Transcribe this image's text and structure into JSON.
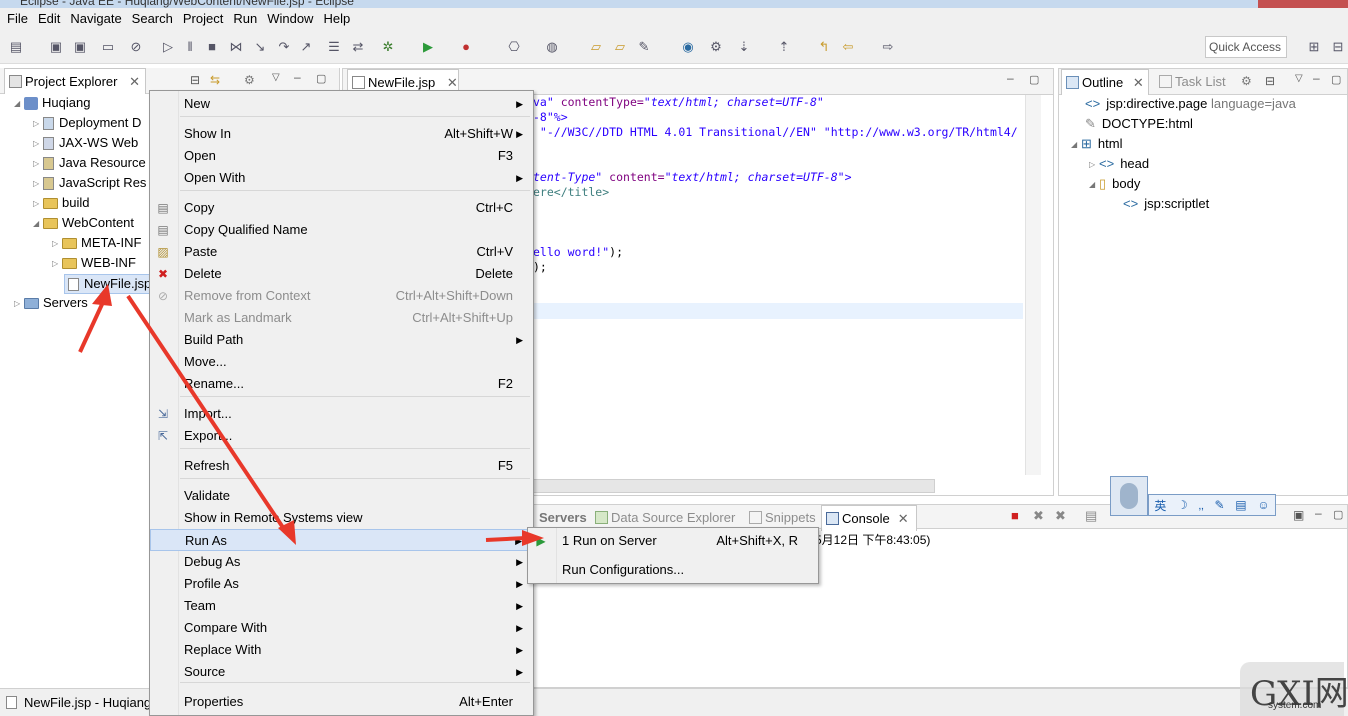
{
  "window": {
    "title": "Eclipse - Java EE - Huqiang/WebContent/NewFile.jsp - Eclipse"
  },
  "menubar": [
    "File",
    "Edit",
    "Navigate",
    "Search",
    "Project",
    "Run",
    "Window",
    "Help"
  ],
  "toolbar": {
    "quick_access": "Quick Access"
  },
  "project_explorer": {
    "tab": "Project Explorer",
    "tree": [
      {
        "label": "Huqiang"
      },
      {
        "label": "Deployment D"
      },
      {
        "label": "JAX-WS Web"
      },
      {
        "label": "Java Resource"
      },
      {
        "label": "JavaScript Res"
      },
      {
        "label": "build"
      },
      {
        "label": "WebContent"
      },
      {
        "label": "META-INF"
      },
      {
        "label": "WEB-INF"
      },
      {
        "label": "NewFile.jsp"
      },
      {
        "label": "Servers"
      }
    ]
  },
  "editor": {
    "tab": "NewFile.jsp",
    "lines": [
      {
        "a": "va\"",
        "b": " contentType=",
        "c": "\"text/html; charset=UTF-8\""
      },
      {
        "a": "-8\"%>",
        "b": "",
        "c": ""
      },
      {
        "a": "",
        "b": " \"-//W3C//DTD HTML 4.01 Transitional//EN\" \"http://www.w3.org/TR/html4/",
        "c": ""
      },
      {
        "a": "tent-Type\"",
        "b": " content=",
        "c": "\"text/html; charset=UTF-8\">"
      },
      {
        "a": "",
        "b": "ere</title>",
        "c": ""
      },
      {
        "a": "ello word!\"",
        "b": ");",
        "c": ""
      },
      {
        "a": "",
        "b": ");",
        "c": ""
      }
    ]
  },
  "outline": {
    "tabs": [
      "Outline",
      "Task List"
    ],
    "items": [
      {
        "label": "jsp:directive.page",
        "extra": " language=java"
      },
      {
        "label": "DOCTYPE:html",
        "extra": ""
      },
      {
        "label": "html",
        "extra": ""
      },
      {
        "label": "head",
        "extra": ""
      },
      {
        "label": "body",
        "extra": ""
      },
      {
        "label": "jsp:scriptlet",
        "extra": ""
      }
    ]
  },
  "bottom_panel": {
    "tabs": [
      "Servers",
      "Data Source Explorer",
      "Snippets",
      "Console"
    ],
    "console_text": "5月12日 下午8:43:05)"
  },
  "status": {
    "text": "NewFile.jsp - Huqiang"
  },
  "ime": {
    "label": "英"
  },
  "context_menu": {
    "items": [
      {
        "label": "New",
        "shortcut": "",
        "submenu": true,
        "disabled": false
      },
      {
        "label": "Show In",
        "shortcut": "Alt+Shift+W",
        "submenu": true,
        "disabled": false
      },
      {
        "label": "Open",
        "shortcut": "F3",
        "submenu": false,
        "disabled": false
      },
      {
        "label": "Open With",
        "shortcut": "",
        "submenu": true,
        "disabled": false
      },
      {
        "label": "Copy",
        "shortcut": "Ctrl+C",
        "submenu": false,
        "disabled": false
      },
      {
        "label": "Copy Qualified Name",
        "shortcut": "",
        "submenu": false,
        "disabled": false
      },
      {
        "label": "Paste",
        "shortcut": "Ctrl+V",
        "submenu": false,
        "disabled": false
      },
      {
        "label": "Delete",
        "shortcut": "Delete",
        "submenu": false,
        "disabled": false
      },
      {
        "label": "Remove from Context",
        "shortcut": "Ctrl+Alt+Shift+Down",
        "submenu": false,
        "disabled": true
      },
      {
        "label": "Mark as Landmark",
        "shortcut": "Ctrl+Alt+Shift+Up",
        "submenu": false,
        "disabled": true
      },
      {
        "label": "Build Path",
        "shortcut": "",
        "submenu": true,
        "disabled": false
      },
      {
        "label": "Move...",
        "shortcut": "",
        "submenu": false,
        "disabled": false
      },
      {
        "label": "Rename...",
        "shortcut": "F2",
        "submenu": false,
        "disabled": false
      },
      {
        "label": "Import...",
        "shortcut": "",
        "submenu": false,
        "disabled": false
      },
      {
        "label": "Export...",
        "shortcut": "",
        "submenu": false,
        "disabled": false
      },
      {
        "label": "Refresh",
        "shortcut": "F5",
        "submenu": false,
        "disabled": false
      },
      {
        "label": "Validate",
        "shortcut": "",
        "submenu": false,
        "disabled": false
      },
      {
        "label": "Show in Remote Systems view",
        "shortcut": "",
        "submenu": false,
        "disabled": false
      },
      {
        "label": "Run As",
        "shortcut": "",
        "submenu": true,
        "disabled": false
      },
      {
        "label": "Debug As",
        "shortcut": "",
        "submenu": true,
        "disabled": false
      },
      {
        "label": "Profile As",
        "shortcut": "",
        "submenu": true,
        "disabled": false
      },
      {
        "label": "Team",
        "shortcut": "",
        "submenu": true,
        "disabled": false
      },
      {
        "label": "Compare With",
        "shortcut": "",
        "submenu": true,
        "disabled": false
      },
      {
        "label": "Replace With",
        "shortcut": "",
        "submenu": true,
        "disabled": false
      },
      {
        "label": "Source",
        "shortcut": "",
        "submenu": true,
        "disabled": false
      },
      {
        "label": "Properties",
        "shortcut": "Alt+Enter",
        "submenu": false,
        "disabled": false
      }
    ]
  },
  "run_as_submenu": [
    {
      "label": "1 Run on Server",
      "shortcut": "Alt+Shift+X, R"
    },
    {
      "label": "Run Configurations...",
      "shortcut": ""
    }
  ],
  "watermark": {
    "text": "GXI网",
    "sub": "system.com"
  },
  "colors": {
    "highlight": "#dae6f7",
    "arrow": "#e8382a",
    "menu_bg": "#f0f0f0",
    "keyword": "#2a00ff"
  }
}
